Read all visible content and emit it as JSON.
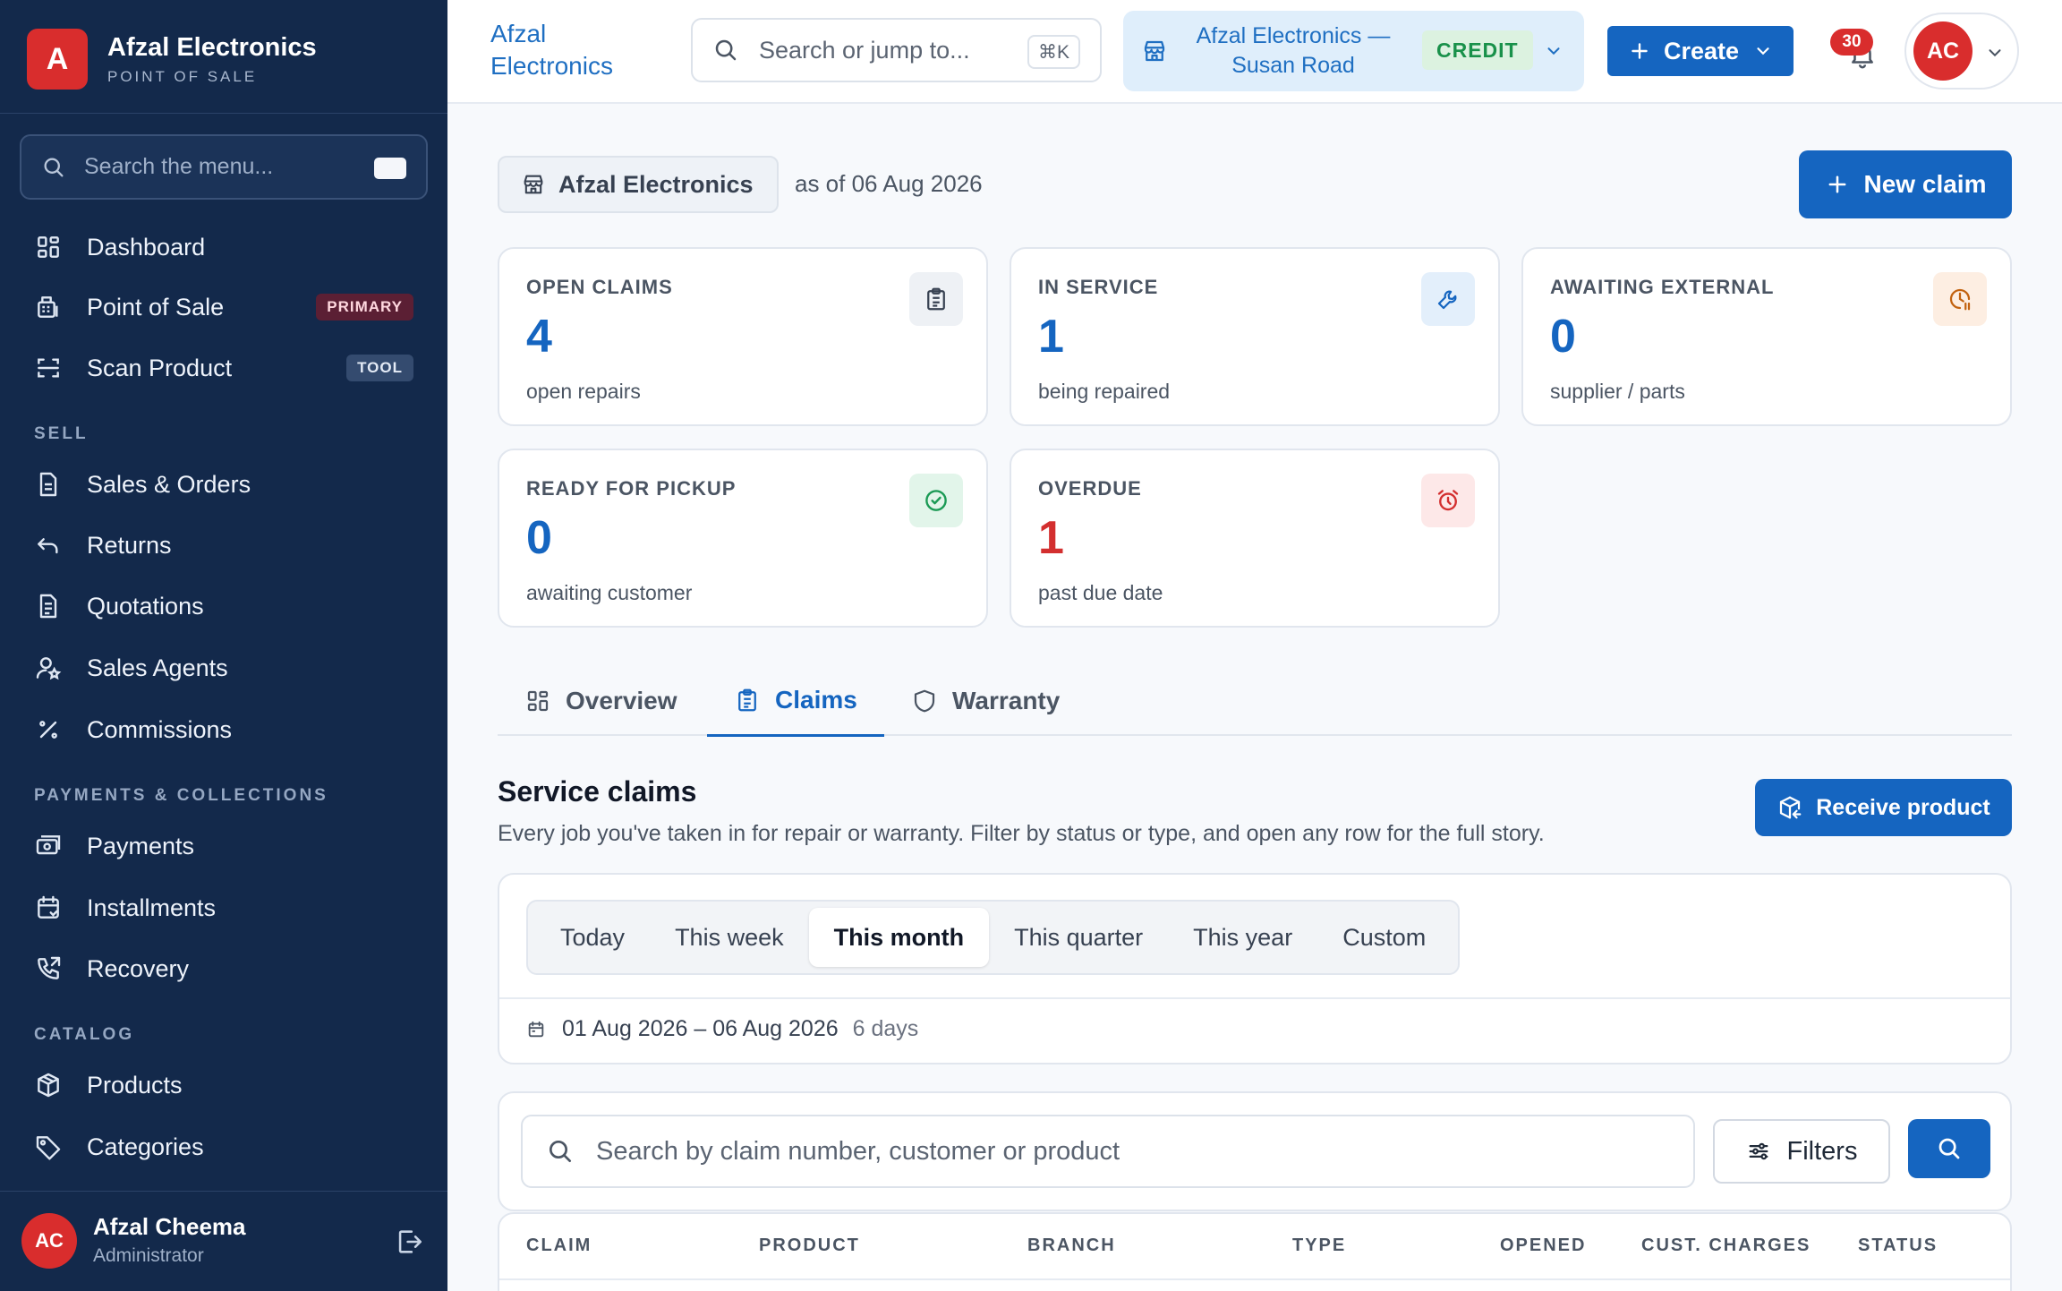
{
  "brand": {
    "logo_letter": "A",
    "name": "Afzal Electronics",
    "subtitle": "POINT OF SALE"
  },
  "sidebar": {
    "search_placeholder": "Search the menu...",
    "items": [
      {
        "label": "Dashboard",
        "icon": "dashboard-icon"
      },
      {
        "label": "Point of Sale",
        "icon": "pos-icon",
        "badge": "PRIMARY"
      },
      {
        "label": "Scan Product",
        "icon": "scan-icon",
        "badge": "TOOL"
      },
      {
        "label": "Sales & Orders",
        "icon": "document-icon"
      },
      {
        "label": "Returns",
        "icon": "return-icon"
      },
      {
        "label": "Quotations",
        "icon": "quote-icon"
      },
      {
        "label": "Sales Agents",
        "icon": "agent-icon"
      },
      {
        "label": "Commissions",
        "icon": "percent-icon"
      },
      {
        "label": "Payments",
        "icon": "payment-icon"
      },
      {
        "label": "Installments",
        "icon": "calendar-icon"
      },
      {
        "label": "Recovery",
        "icon": "phone-icon"
      },
      {
        "label": "Products",
        "icon": "box-icon"
      },
      {
        "label": "Categories",
        "icon": "tag-icon"
      }
    ],
    "sections": {
      "sell": "SELL",
      "payments": "PAYMENTS & COLLECTIONS",
      "catalog": "CATALOG"
    },
    "user": {
      "initials": "AC",
      "name": "Afzal Cheema",
      "role": "Administrator"
    }
  },
  "topbar": {
    "company_link": "Afzal Electronics",
    "search_placeholder": "Search or jump to...",
    "search_shortcut": "⌘K",
    "branch": "Afzal Electronics — Susan Road",
    "branch_mode": "CREDIT",
    "create_label": "Create",
    "notification_count": "30",
    "avatar_initials": "AC"
  },
  "main": {
    "company_pill": "Afzal Electronics",
    "as_of": "as of 06 Aug 2026",
    "new_claim_label": "New claim",
    "stats": [
      {
        "title": "OPEN CLAIMS",
        "value": "4",
        "sub": "open repairs",
        "icon": "clipboard-icon",
        "color": "#1565c0"
      },
      {
        "title": "IN SERVICE",
        "value": "1",
        "sub": "being repaired",
        "icon": "wrench-icon",
        "color": "#1565c0"
      },
      {
        "title": "AWAITING EXTERNAL",
        "value": "0",
        "sub": "supplier / parts",
        "icon": "clock-pause-icon",
        "color": "#1565c0"
      },
      {
        "title": "READY FOR PICKUP",
        "value": "0",
        "sub": "awaiting customer",
        "icon": "check-circle-icon",
        "color": "#1565c0"
      },
      {
        "title": "OVERDUE",
        "value": "1",
        "sub": "past due date",
        "icon": "alarm-icon",
        "color": "#d32f2f"
      }
    ],
    "tabs": [
      {
        "label": "Overview",
        "icon": "overview-icon"
      },
      {
        "label": "Claims",
        "icon": "clipboard-icon",
        "active": true
      },
      {
        "label": "Warranty",
        "icon": "shield-icon"
      }
    ],
    "section_title": "Service claims",
    "section_desc": "Every job you've taken in for repair or warranty. Filter by status or type, and open any row for the full story.",
    "receive_label": "Receive product",
    "periods": [
      "Today",
      "This week",
      "This month",
      "This quarter",
      "This year",
      "Custom"
    ],
    "active_period": "This month",
    "range": "01 Aug 2026 – 06 Aug 2026",
    "range_days": "6 days",
    "claim_search_placeholder": "Search by claim number, customer or product",
    "filters_label": "Filters",
    "columns": [
      "CLAIM",
      "PRODUCT",
      "BRANCH",
      "TYPE",
      "OPENED",
      "CUST. CHARGES",
      "STATUS"
    ]
  }
}
